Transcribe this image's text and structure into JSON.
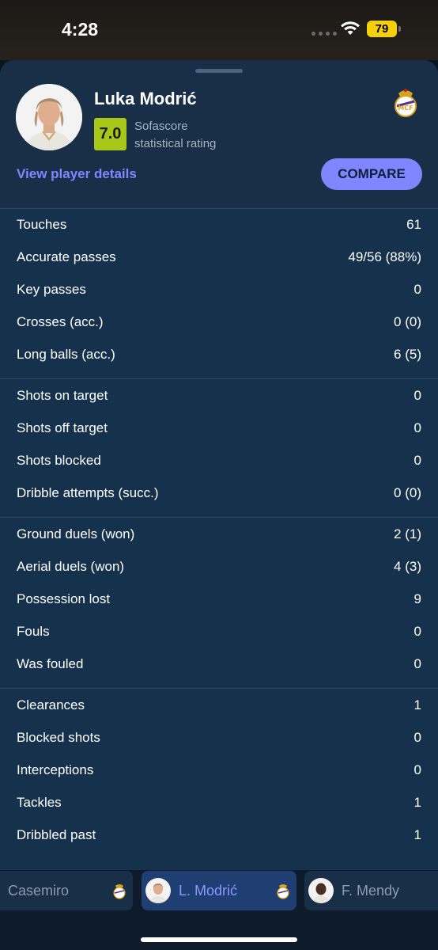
{
  "status_bar": {
    "time": "4:28",
    "battery": "79"
  },
  "player": {
    "name": "Luka Modrić",
    "rating": "7.0",
    "rating_label_line1": "Sofascore",
    "rating_label_line2": "statistical rating",
    "details_link": "View player details",
    "compare_label": "COMPARE"
  },
  "stat_groups": [
    [
      {
        "label": "Touches",
        "value": "61"
      },
      {
        "label": "Accurate passes",
        "value": "49/56 (88%)"
      },
      {
        "label": "Key passes",
        "value": "0"
      },
      {
        "label": "Crosses (acc.)",
        "value": "0 (0)"
      },
      {
        "label": "Long balls (acc.)",
        "value": "6 (5)"
      }
    ],
    [
      {
        "label": "Shots on target",
        "value": "0"
      },
      {
        "label": "Shots off target",
        "value": "0"
      },
      {
        "label": "Shots blocked",
        "value": "0"
      },
      {
        "label": "Dribble attempts (succ.)",
        "value": "0 (0)"
      }
    ],
    [
      {
        "label": "Ground duels (won)",
        "value": "2 (1)"
      },
      {
        "label": "Aerial duels (won)",
        "value": "4 (3)"
      },
      {
        "label": "Possession lost",
        "value": "9"
      },
      {
        "label": "Fouls",
        "value": "0"
      },
      {
        "label": "Was fouled",
        "value": "0"
      }
    ],
    [
      {
        "label": "Clearances",
        "value": "1"
      },
      {
        "label": "Blocked shots",
        "value": "0"
      },
      {
        "label": "Interceptions",
        "value": "0"
      },
      {
        "label": "Tackles",
        "value": "1"
      },
      {
        "label": "Dribbled past",
        "value": "1"
      }
    ]
  ],
  "player_bar": [
    {
      "name": "Casemiro",
      "active": false
    },
    {
      "name": "L. Modrić",
      "active": true
    },
    {
      "name": "F. Mendy",
      "active": false
    }
  ],
  "colors": {
    "accent": "#7f86ff",
    "rating_badge": "#a8c819",
    "sheet_background": "#16314c",
    "battery": "#f5d10c"
  }
}
